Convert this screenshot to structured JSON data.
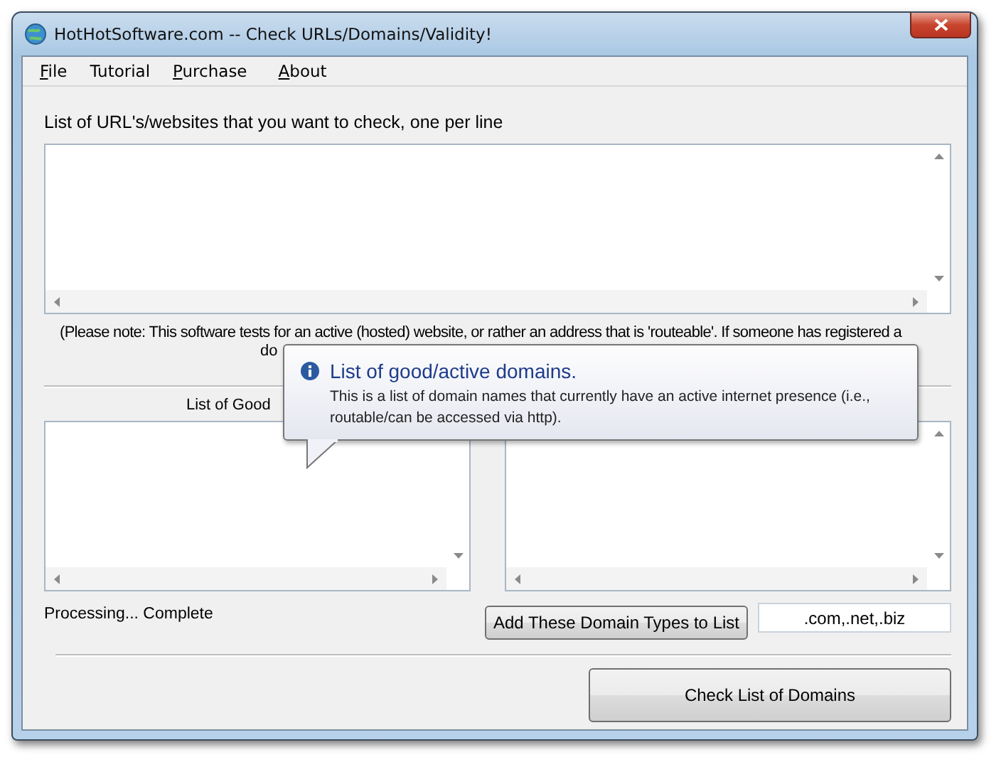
{
  "window": {
    "title": "HotHotSoftware.com -- Check URLs/Domains/Validity!"
  },
  "menu": [
    {
      "label": "File",
      "underline": true
    },
    {
      "label": "Tutorial",
      "underline": false
    },
    {
      "label": "Purchase",
      "underline": true
    },
    {
      "label": "About",
      "underline": true
    }
  ],
  "url_list": {
    "label": "List of URL's/websites that you want to check, one per line"
  },
  "note": [
    "(Please note: This software tests for an active (hosted) website, or rather an address that is 'routeable'. If someone has registered a",
    "do"
  ],
  "good_list": {
    "label": "List of Good"
  },
  "status": "Processing... Complete",
  "add_types_button": "Add These Domain Types to List",
  "domain_types_field": {
    "value": ".com,.net,.biz"
  },
  "check_button": "Check List of Domains",
  "tooltip": {
    "title": "List of good/active domains.",
    "text": "This is a list of domain names that currently have an active internet presence (i.e., routable/can be accessed via http)."
  }
}
